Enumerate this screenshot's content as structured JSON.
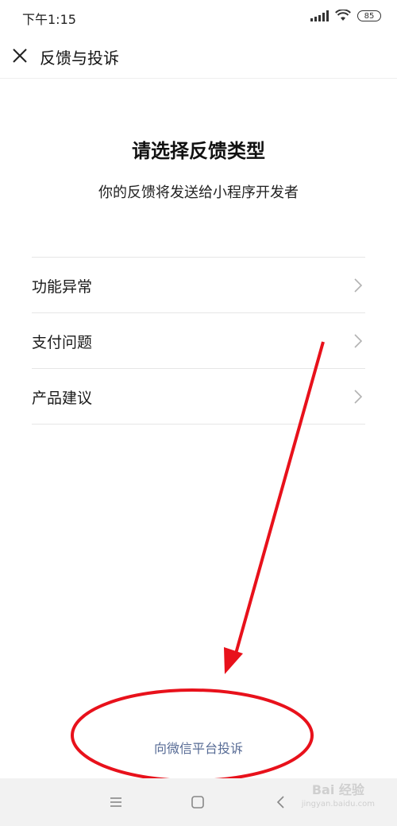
{
  "status_bar": {
    "time": "下午1:15",
    "battery": "85"
  },
  "header": {
    "title": "反馈与投诉",
    "close_icon": "close-icon"
  },
  "main": {
    "heading": "请选择反馈类型",
    "subheading": "你的反馈将发送给小程序开发者",
    "options": [
      {
        "label": "功能异常"
      },
      {
        "label": "支付问题"
      },
      {
        "label": "产品建议"
      }
    ]
  },
  "footer": {
    "complain_link": "向微信平台投诉",
    "link_color": "#576b95"
  },
  "nav_bar": {
    "menu_icon": "menu-icon",
    "home_icon": "home-icon",
    "back_icon": "back-icon"
  },
  "annotation": {
    "color": "#e8111b"
  },
  "watermark": {
    "line1": "Bai 经验",
    "line2": "jingyan.baidu.com"
  }
}
